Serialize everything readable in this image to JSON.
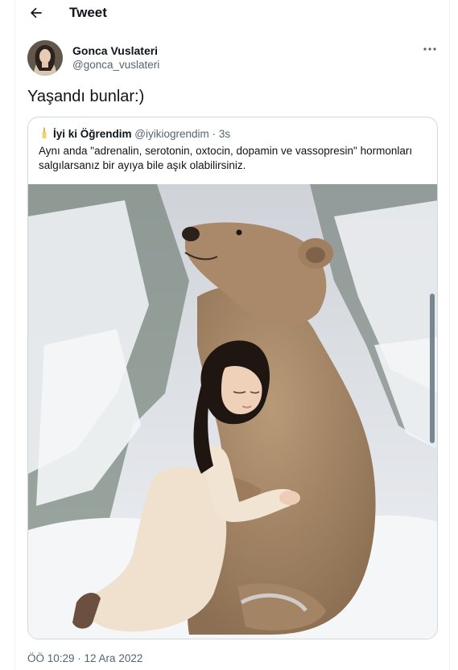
{
  "header": {
    "title": "Tweet",
    "back_icon": "arrow-left-icon"
  },
  "author": {
    "name": "Gonca Vuslateri",
    "handle": "@gonca_vuslateri"
  },
  "tweet": {
    "text": "Yaşandı bunlar:)",
    "timestamp": "ÖÖ 10:29 · 12 Ara 2022"
  },
  "quote": {
    "emoji": "candle-icon",
    "name": "İyi ki Öğrendim",
    "handle": "@iyikiogrendim",
    "separator": "·",
    "time": "3s",
    "text": "Aynı anda \"adrenalin, serotonin, oxtocin, dopamin ve vassopresin\" hormonları salgılarsanız bir ayıya bile aşık olabilirsiniz."
  },
  "colors": {
    "text": "#0f1419",
    "secondary": "#536471",
    "border": "#cfd9de",
    "divider": "#eff3f4"
  }
}
